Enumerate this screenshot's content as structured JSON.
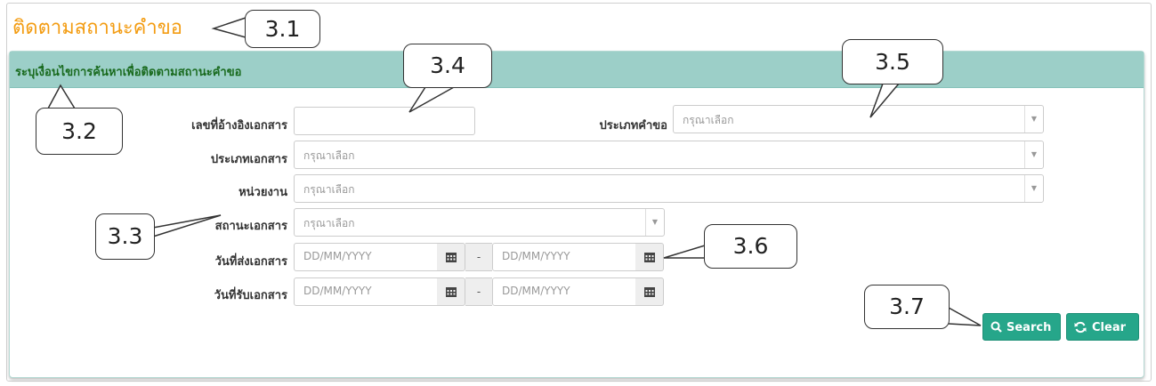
{
  "page": {
    "title": "ติดตามสถานะคำขอ"
  },
  "panel": {
    "heading": "ระบุเงื่อนไขการค้นหาเพื่อติดตามสถานะคำขอ"
  },
  "form": {
    "ref_no_label": "เลขที่อ้างอิงเอกสาร",
    "ref_no_value": "",
    "request_type_label": "ประเภทคำขอ",
    "request_type_value": "กรุณาเลือก",
    "doc_type_label": "ประเภทเอกสาร",
    "doc_type_value": "กรุณาเลือก",
    "agency_label": "หน่วยงาน",
    "agency_value": "กรุณาเลือก",
    "doc_status_label": "สถานะเอกสาร",
    "doc_status_value": "กรุณาเลือก",
    "sent_date_label": "วันที่ส่งเอกสาร",
    "received_date_label": "วันที่รับเอกสาร",
    "date_placeholder": "DD/MM/YYYY",
    "range_separator": "-"
  },
  "buttons": {
    "search_label": "Search",
    "clear_label": "Clear"
  },
  "callouts": {
    "c31": "3.1",
    "c32": "3.2",
    "c33": "3.3",
    "c34": "3.4",
    "c35": "3.5",
    "c36": "3.6",
    "c37": "3.7"
  },
  "icons": {
    "calendar": "calendar-icon",
    "search": "search-icon",
    "refresh": "refresh-icon",
    "caret": "caret-down-icon"
  },
  "colors": {
    "title": "#f39c12",
    "panel_header": "#9ccfc8",
    "panel_heading_text": "#1a6b1f",
    "button": "#26a68a"
  }
}
